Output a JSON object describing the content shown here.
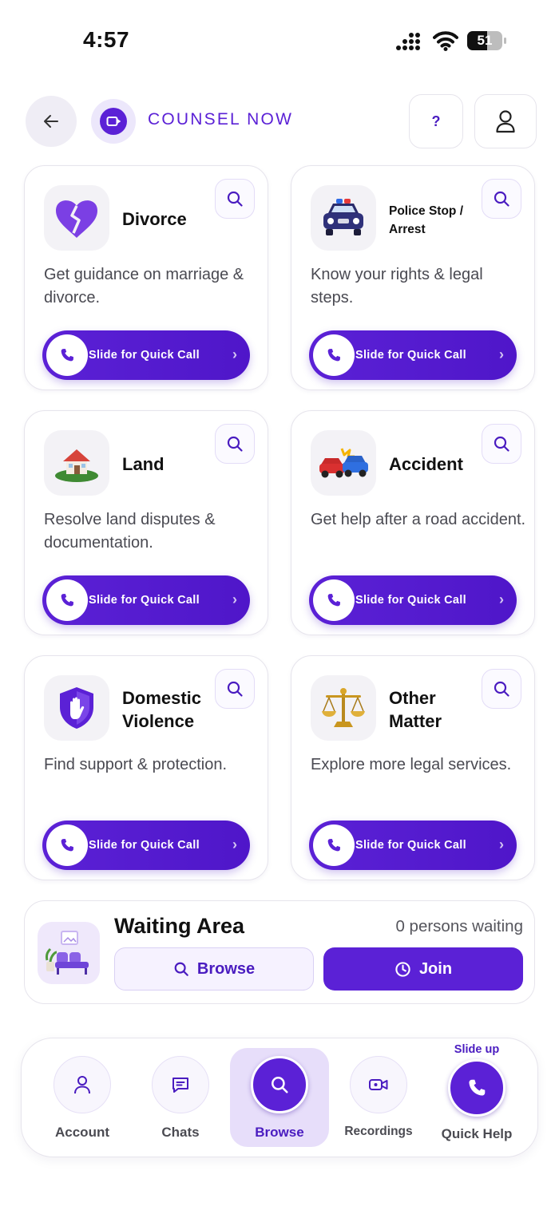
{
  "status_bar": {
    "time": "4:57",
    "battery": "51"
  },
  "header": {
    "brand": "COUNSEL NOW",
    "help_label": "?"
  },
  "cards": [
    {
      "title": "Divorce",
      "description": "Get guidance on marriage & divorce.",
      "slider_label": "Slide for Quick Call",
      "icon": "broken-heart-icon"
    },
    {
      "title": "Police Stop / Arrest",
      "description": "Know your rights & legal steps.",
      "slider_label": "Slide for Quick Call",
      "icon": "police-car-icon"
    },
    {
      "title": "Land",
      "description": "Resolve land disputes & documentation.",
      "slider_label": "Slide for Quick Call",
      "icon": "house-land-icon"
    },
    {
      "title": "Accident",
      "description": "Get help after a road accident.",
      "slider_label": "Slide for Quick Call",
      "icon": "car-crash-icon"
    },
    {
      "title": "Domestic Violence",
      "description": "Find support & protection.",
      "slider_label": "Slide for Quick Call",
      "icon": "shield-hand-icon"
    },
    {
      "title": "Other Matter",
      "description": "Explore more legal services.",
      "slider_label": "Slide for Quick Call",
      "icon": "scales-icon"
    }
  ],
  "waiting_area": {
    "title": "Waiting Area",
    "count": "0 persons waiting",
    "browse_label": "Browse",
    "join_label": "Join"
  },
  "nav": {
    "items": [
      {
        "label": "Account",
        "icon": "person-icon"
      },
      {
        "label": "Chats",
        "icon": "chat-icon"
      },
      {
        "label": "Browse",
        "icon": "search-icon"
      },
      {
        "label": "Recordings",
        "icon": "video-icon"
      },
      {
        "label": "Quick Help",
        "icon": "phone-icon"
      }
    ],
    "slide_up": "Slide up"
  },
  "colors": {
    "accent": "#5b21d6",
    "accent_light": "#e7defa"
  }
}
